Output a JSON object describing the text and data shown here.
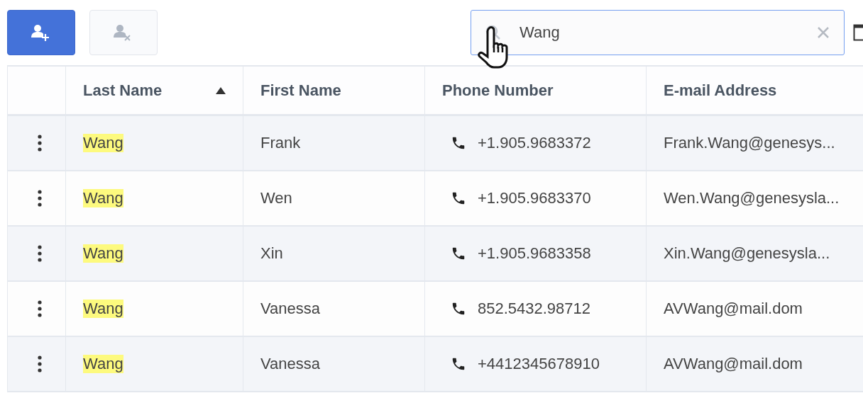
{
  "toolbar": {
    "add_button": {
      "disabled": false
    },
    "remove_button": {
      "disabled": true
    }
  },
  "search": {
    "value": "Wang"
  },
  "table": {
    "columns": [
      {
        "label": "Last Name",
        "sorted": true
      },
      {
        "label": "First Name",
        "sorted": false
      },
      {
        "label": "Phone Number",
        "sorted": false
      },
      {
        "label": "E-mail Address",
        "sorted": false
      }
    ],
    "rows": [
      {
        "last_name": "Wang",
        "highlighted": true,
        "first_name": "Frank",
        "phone": "+1.905.9683372",
        "email": "Frank.Wang@genesys..."
      },
      {
        "last_name": "Wang",
        "highlighted": true,
        "first_name": "Wen",
        "phone": "+1.905.9683370",
        "email": "Wen.Wang@genesysla..."
      },
      {
        "last_name": "Wang",
        "highlighted": true,
        "first_name": "Xin",
        "phone": "+1.905.9683358",
        "email": "Xin.Wang@genesysla..."
      },
      {
        "last_name": "Wang",
        "highlighted": true,
        "first_name": "Vanessa",
        "phone": "852.5432.98712",
        "email": "AVWang@mail.dom"
      },
      {
        "last_name": "Wang",
        "highlighted": true,
        "first_name": "Vanessa",
        "phone": "+4412345678910",
        "email": "AVWang@mail.dom"
      }
    ]
  }
}
